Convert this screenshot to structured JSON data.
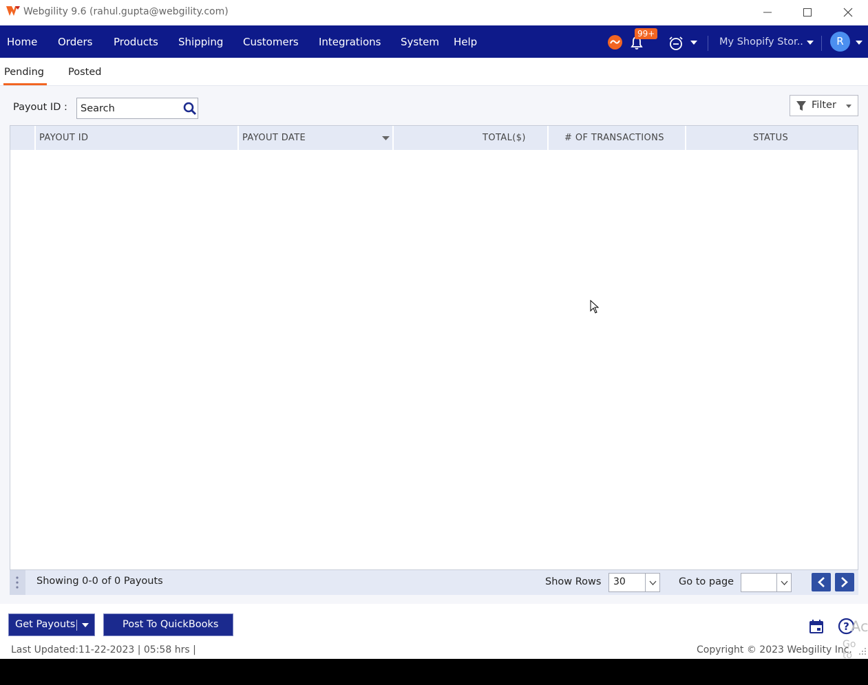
{
  "window": {
    "title": "Webgility 9.6 (rahul.gupta@webgility.com)",
    "controls": [
      "minimize-icon",
      "maximize-icon",
      "close-icon"
    ]
  },
  "nav": {
    "items": [
      {
        "label": "Home"
      },
      {
        "label": "Orders"
      },
      {
        "label": "Products"
      },
      {
        "label": "Shipping"
      },
      {
        "label": "Customers"
      },
      {
        "label": "Integrations"
      },
      {
        "label": "System"
      },
      {
        "label": "Help"
      }
    ],
    "notification_badge": "99+",
    "store_name": "My Shopify Stor..",
    "avatar_initial": "R",
    "icons": [
      "sync-status-icon",
      "bell-icon",
      "alarm-clock-icon",
      "chevron-down-icon"
    ]
  },
  "tabs": [
    {
      "label": "Pending",
      "active": true
    },
    {
      "label": "Posted",
      "active": false
    }
  ],
  "search": {
    "label": "Payout ID :",
    "placeholder": "Search",
    "value": ""
  },
  "filter": {
    "label": "Filter"
  },
  "grid": {
    "columns": [
      "PAYOUT ID",
      "PAYOUT DATE",
      "TOTAL($)",
      "# OF TRANSACTIONS",
      "STATUS"
    ],
    "rows": []
  },
  "pager": {
    "showing": "Showing 0-0 of 0 Payouts",
    "show_rows_label": "Show Rows",
    "rows_value": "30",
    "goto_label": "Go to page",
    "goto_value": ""
  },
  "footer": {
    "get_payouts": "Get Payouts",
    "post_to_quickbooks": "Post To QuickBooks",
    "last_updated": "Last Updated:11-22-2023 | 05:58 hrs |",
    "copyright": "Copyright © 2023 Webgility Inc.",
    "watermark_line1": "Act",
    "watermark_line2": "Go to"
  },
  "colors": {
    "nav_bg": "#0e1a8a",
    "accent": "#f26522",
    "grid_header": "#e4e9f5",
    "primary_button": "#1b2a8e"
  }
}
